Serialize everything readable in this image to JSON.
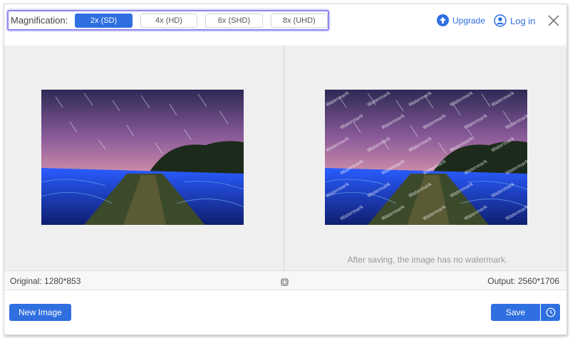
{
  "magnification": {
    "label": "Magnification:",
    "options": [
      "2x (SD)",
      "4x (HD)",
      "6x (SHD)",
      "8x (UHD)"
    ],
    "selected": "2x (SD)"
  },
  "header": {
    "upgrade_label": "Upgrade",
    "login_label": "Log in",
    "icons": [
      "upgrade-arrow-icon",
      "user-icon",
      "close-icon"
    ]
  },
  "preview": {
    "watermark_text": "Watermark",
    "note": "After saving, the image has no watermark."
  },
  "info": {
    "original": "Original: 1280*853",
    "output": "Output: 2560*1706"
  },
  "footer": {
    "new_image_label": "New Image",
    "save_label": "Save"
  },
  "colors": {
    "accent": "#2f6fe0",
    "highlight": "#8d86f0"
  }
}
